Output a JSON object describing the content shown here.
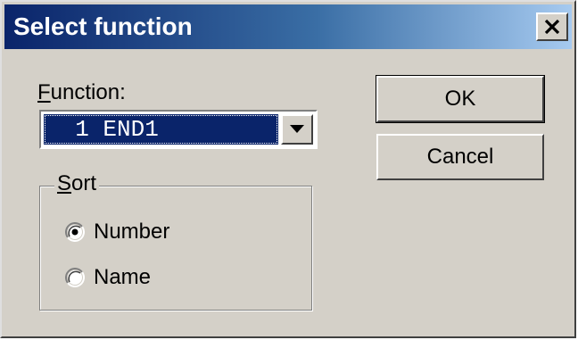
{
  "window": {
    "title": "Select function",
    "close_icon": "close-icon"
  },
  "function_field": {
    "label_mnemonic": "F",
    "label_rest": "unction:",
    "selected_value": "  1 END1",
    "dropdown_icon": "chevron-down-icon"
  },
  "sort_group": {
    "legend_mnemonic": "S",
    "legend_rest": "ort",
    "options": [
      {
        "label": "Number",
        "selected": true
      },
      {
        "label": "Name",
        "selected": false
      }
    ]
  },
  "buttons": {
    "ok_label": "OK",
    "cancel_label": "Cancel"
  },
  "colors": {
    "title_gradient_start": "#0a246a",
    "title_gradient_end": "#a6caf0",
    "selection": "#0a246a",
    "face": "#d4d0c8"
  }
}
